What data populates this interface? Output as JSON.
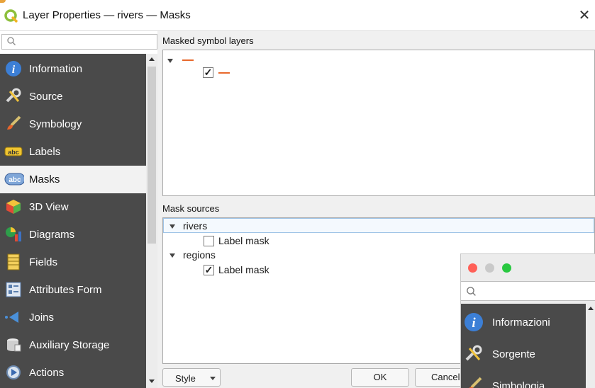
{
  "window": {
    "title": "Layer Properties — rivers — Masks",
    "close_glyph": "✕"
  },
  "sidebar": {
    "search_placeholder": "",
    "items": [
      {
        "label": "Information",
        "icon": "info-icon"
      },
      {
        "label": "Source",
        "icon": "source-icon"
      },
      {
        "label": "Symbology",
        "icon": "symbology-brush-icon"
      },
      {
        "label": "Labels",
        "icon": "labels-abc-icon"
      },
      {
        "label": "Masks",
        "icon": "masks-abc-icon",
        "selected": true
      },
      {
        "label": "3D View",
        "icon": "3d-cube-icon"
      },
      {
        "label": "Diagrams",
        "icon": "diagrams-icon"
      },
      {
        "label": "Fields",
        "icon": "fields-icon"
      },
      {
        "label": "Attributes Form",
        "icon": "attributes-form-icon"
      },
      {
        "label": "Joins",
        "icon": "joins-icon"
      },
      {
        "label": "Auxiliary Storage",
        "icon": "auxiliary-storage-icon"
      },
      {
        "label": "Actions",
        "icon": "actions-icon"
      }
    ]
  },
  "masked_symbol_layers": {
    "label": "Masked symbol layers",
    "line_color": "#e8692c",
    "child_checked": true,
    "check_glyph": "✓"
  },
  "mask_sources": {
    "label": "Mask sources",
    "groups": [
      {
        "name": "rivers",
        "child_label": "Label mask",
        "checked": false
      },
      {
        "name": "regions",
        "child_label": "Label mask",
        "checked": true
      }
    ]
  },
  "footer": {
    "style_label": "Style",
    "ok_label": "OK",
    "cancel_label": "Cancel"
  },
  "overlay": {
    "traffic_lights": [
      "#ff5f57",
      "#c9c9c9",
      "#28c840"
    ],
    "items": [
      {
        "label": "Informazioni",
        "icon": "info-icon"
      },
      {
        "label": "Sorgente",
        "icon": "source-icon"
      },
      {
        "label": "Simbologia",
        "icon": "symbology-brush-icon"
      }
    ]
  }
}
